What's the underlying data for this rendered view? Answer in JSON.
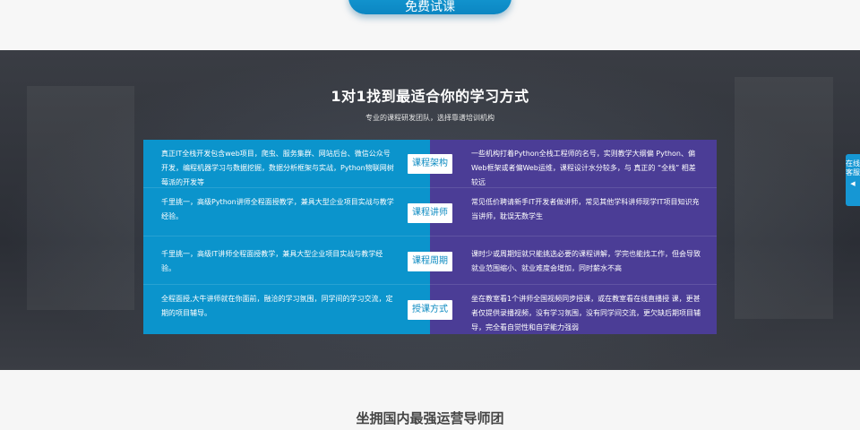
{
  "top": {
    "cta_label": "免费试课"
  },
  "hero": {
    "title": "1对1找到最适合你的学习方式",
    "subtitle": "专业的课程研发团队，选择靠谱培训机构"
  },
  "comparison": [
    {
      "left": "真正IT全栈开发包含web项目，爬虫、服务集群、网站后台、微信公众号开发，编程机器学习与数据挖掘，数据分析框架与实战，Python物联网树莓派的开发等",
      "tag": "课程架构",
      "right": "一些机构打着Python全栈工程师的名号，实则教学大纲偏 Python、偏Web框架或者偏Web运维，课程设计水分较多，与 真正的 “全栈” 相差较远"
    },
    {
      "left": "千里挑一，高级Python讲师全程面授教学，兼具大型企业项目实战与教学经验。",
      "tag": "课程讲师",
      "right": "常见低价聘请新手IT开发者做讲师，常见其他学科讲师现学IT项目知识充当讲师，耽误无数学生"
    },
    {
      "left": "千里挑一，高级IT讲师全程面授教学，兼具大型企业项目实战与教学经验。",
      "tag": "课程周期",
      "right": "课时少或周期短就只能挑选必要的课程讲解，学完也能找工作，但会导致就业范围缩小、就业难度会增加，同时薪水不高"
    },
    {
      "left": "全程面授,大牛讲师就在你面前，融洽的学习氛围，同学间的学习交流，定期的项目辅导。",
      "tag": "授课方式",
      "right": "坐在教室看1个讲师全国视频同步授课，或在教室看在线直播授 课，更甚者仅提供录播视频，没有学习氛围，没有同学间交流，更欠缺后期项目辅导，完全看自觉性和自学能力强弱"
    }
  ],
  "section2": {
    "title": "坐拥国内最强运营导师团"
  },
  "float_service": {
    "label": "在线客服"
  }
}
